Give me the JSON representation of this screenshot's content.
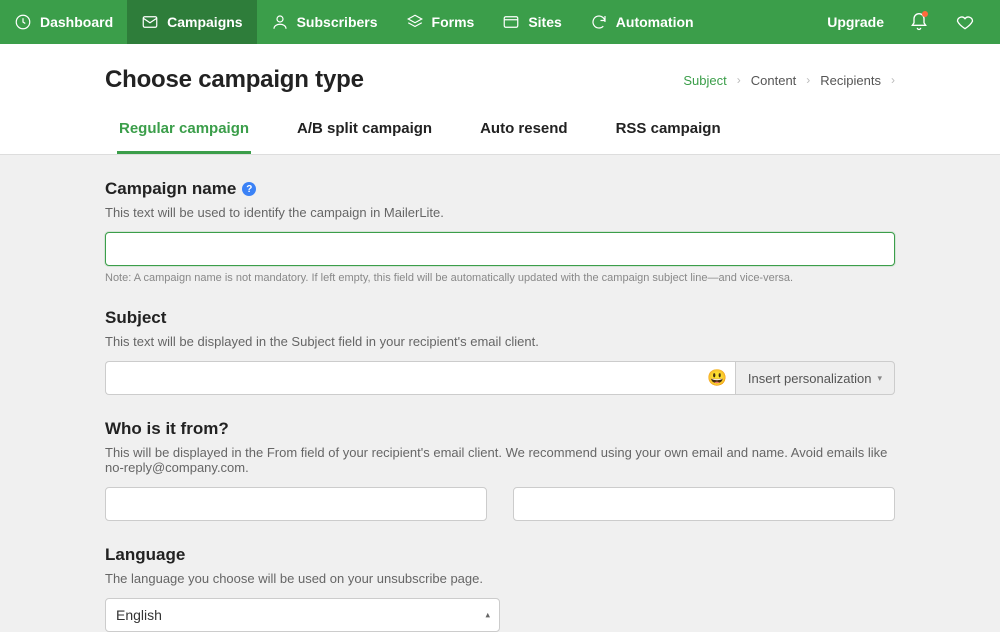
{
  "nav": {
    "items": [
      {
        "label": "Dashboard",
        "icon": "clock"
      },
      {
        "label": "Campaigns",
        "icon": "mail",
        "active": true
      },
      {
        "label": "Subscribers",
        "icon": "user"
      },
      {
        "label": "Forms",
        "icon": "layers"
      },
      {
        "label": "Sites",
        "icon": "browser"
      },
      {
        "label": "Automation",
        "icon": "refresh"
      }
    ],
    "upgrade": "Upgrade"
  },
  "header": {
    "title": "Choose campaign type",
    "breadcrumb": [
      {
        "label": "Subject",
        "active": true
      },
      {
        "label": "Content"
      },
      {
        "label": "Recipients"
      }
    ],
    "tabs": [
      {
        "label": "Regular campaign",
        "active": true
      },
      {
        "label": "A/B split campaign"
      },
      {
        "label": "Auto resend"
      },
      {
        "label": "RSS campaign"
      }
    ]
  },
  "form": {
    "campaign_name": {
      "title": "Campaign name",
      "desc": "This text will be used to identify the campaign in MailerLite.",
      "value": "",
      "note": "Note: A campaign name is not mandatory. If left empty, this field will be automatically updated with the campaign subject line—and vice-versa."
    },
    "subject": {
      "title": "Subject",
      "desc": "This text will be displayed in the Subject field in your recipient's email client.",
      "value": "",
      "emoji": "😃",
      "personalize_label": "Insert personalization"
    },
    "from": {
      "title": "Who is it from?",
      "desc": "This will be displayed in the From field of your recipient's email client. We recommend using your own email and name. Avoid emails like no-reply@company.com.",
      "name_value": "",
      "email_value": ""
    },
    "language": {
      "title": "Language",
      "desc": "The language you choose will be used on your unsubscribe page.",
      "selected": "English"
    }
  }
}
